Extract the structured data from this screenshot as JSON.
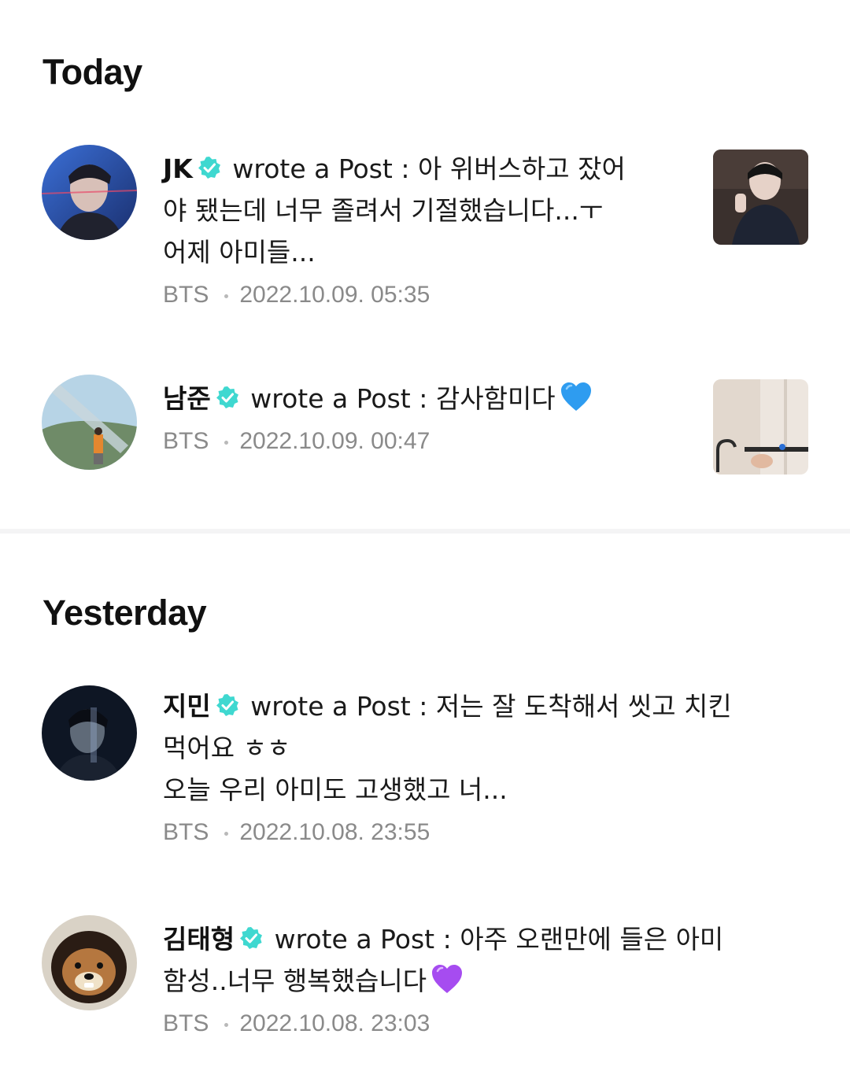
{
  "sections": [
    {
      "title": "Today",
      "items": [
        {
          "author": "JK",
          "action": "wrote a Post :",
          "text": "아 위버스하고 잤어\n야 됐는데 너무 졸려서 기절했습니다...ㅜ\n어제 아미들...",
          "community": "BTS",
          "timestamp": "2022.10.09. 05:35"
        },
        {
          "author": "남준",
          "action": "wrote a Post :",
          "text": "감사함미다",
          "emoji": "blue-heart-icon",
          "community": "BTS",
          "timestamp": "2022.10.09. 00:47"
        }
      ]
    },
    {
      "title": "Yesterday",
      "items": [
        {
          "author": "지민",
          "action": "wrote a Post :",
          "text": "저는 잘 도착해서 씻고 치킨\n먹어요 ㅎㅎ\n오늘 우리 아미도 고생했고 너...",
          "community": "BTS",
          "timestamp": "2022.10.08. 23:55"
        },
        {
          "author": "김태형",
          "action": "wrote a Post :",
          "text": "아주 오랜만에 들은 아미\n함성..너무 행복했습니다",
          "emoji": "purple-heart-icon",
          "community": "BTS",
          "timestamp": "2022.10.08. 23:03"
        }
      ]
    }
  ],
  "colors": {
    "verified": "#3fd8d0",
    "meta": "#8a8a8a",
    "divider": "#f4f4f5",
    "blue_heart": "#2e9cf0",
    "purple_heart": "#a64cf0"
  }
}
